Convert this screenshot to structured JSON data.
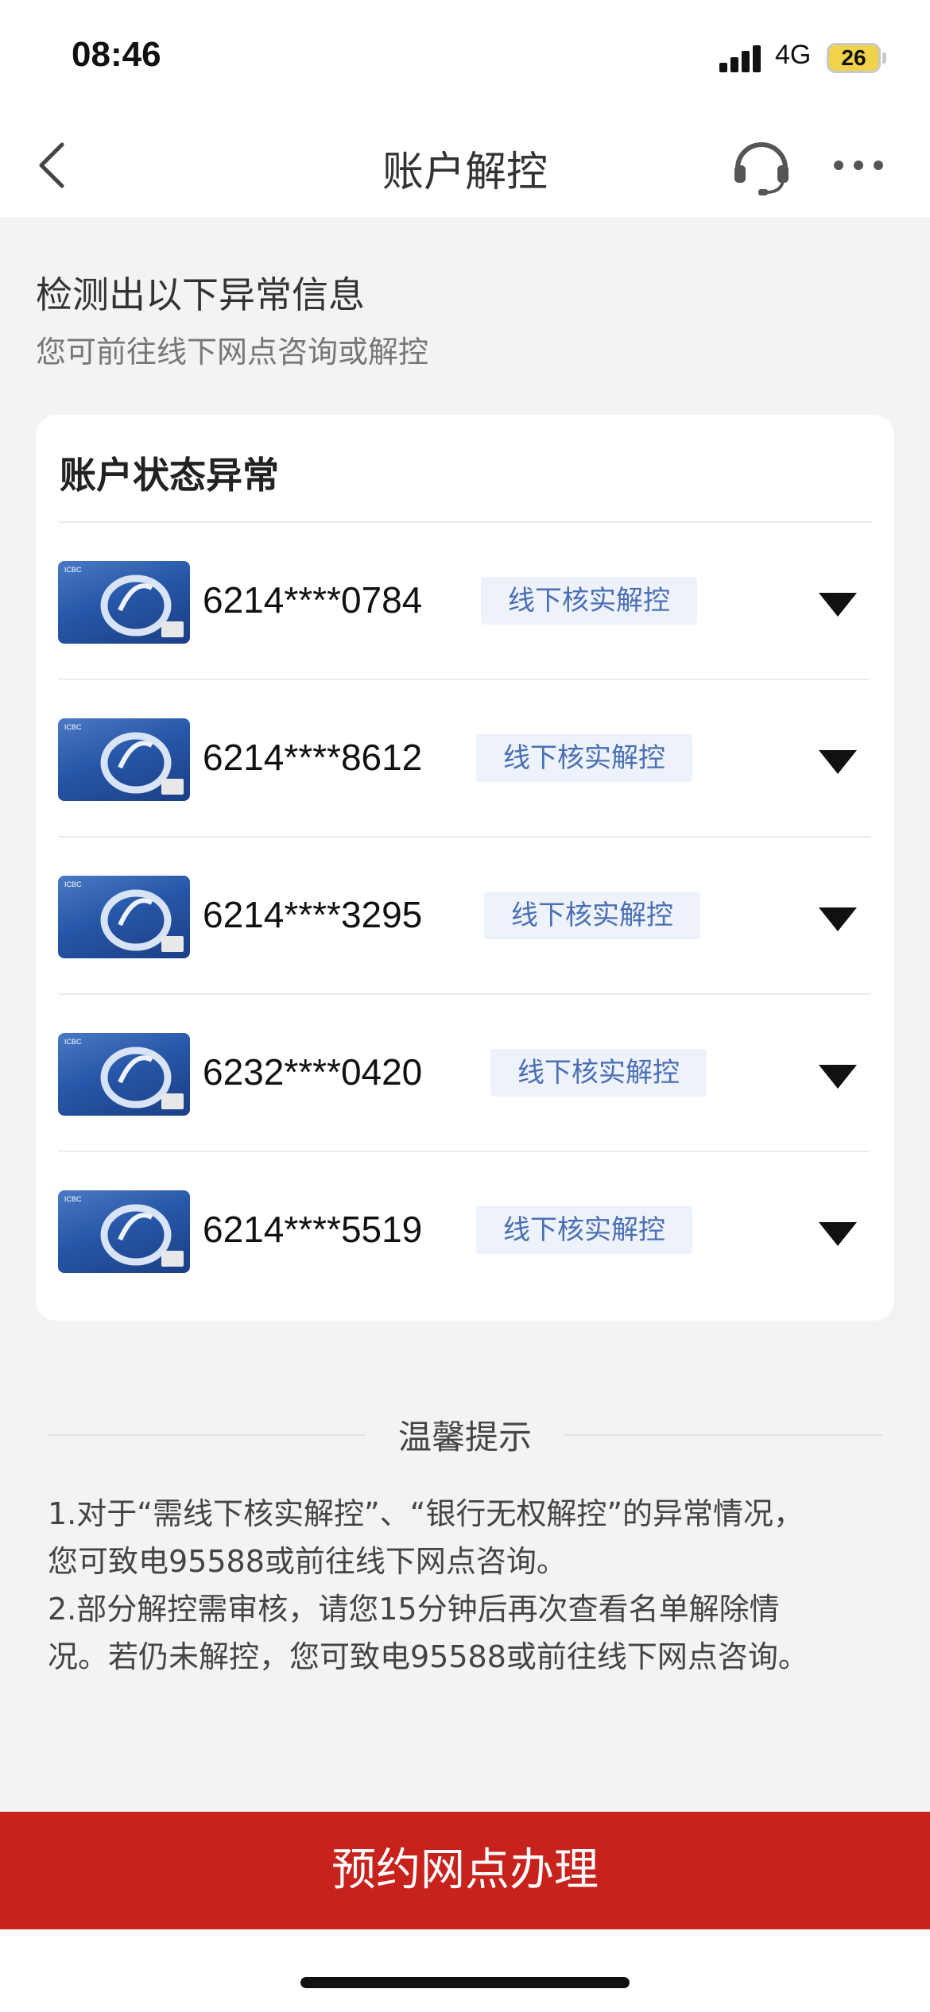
{
  "status_bar": {
    "time": "08:46",
    "network": "4G",
    "battery": "26"
  },
  "nav": {
    "title": "账户解控"
  },
  "intro": {
    "title": "检测出以下异常信息",
    "subtitle": "您可前往线下网点咨询或解控"
  },
  "card": {
    "title": "账户状态异常",
    "accounts": [
      {
        "number": "6214****0784",
        "status": "线下核实解控"
      },
      {
        "number": "6214****8612",
        "status": "线下核实解控"
      },
      {
        "number": "6214****3295",
        "status": "线下核实解控"
      },
      {
        "number": "6232****0420",
        "status": "线下核实解控"
      },
      {
        "number": "6214****5519",
        "status": "线下核实解控"
      }
    ]
  },
  "tips": {
    "title": "温馨提示",
    "line1": "1.对于“需线下核实解控”、“银行无权解控”的异常情况，",
    "line2": "您可致电95588或前往线下网点咨询。",
    "line3": "2.部分解控需审核，请您15分钟后再次查看名单解除情",
    "line4": "况。若仍未解控，您可致电95588或前往线下网点咨询。"
  },
  "cta": {
    "label": "预约网点办理"
  },
  "icons": [
    "back-icon",
    "headset-icon",
    "more-icon",
    "caret-down-icon",
    "bank-card-icon",
    "signal-icon",
    "battery-icon"
  ],
  "colors": {
    "primary": "#c8221d",
    "tag_bg": "#eef2fa",
    "tag_text": "#4a6fb5"
  }
}
